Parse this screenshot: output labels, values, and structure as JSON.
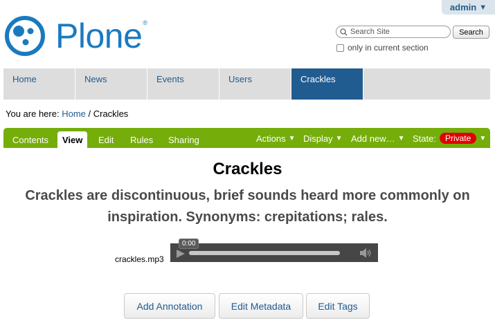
{
  "user_menu": {
    "label": "admin"
  },
  "logo": {
    "text": "Plone",
    "reg_mark": "®"
  },
  "search": {
    "placeholder": "Search Site",
    "button_label": "Search",
    "checkbox_label": "only in current section"
  },
  "portal_tabs": [
    {
      "label": "Home"
    },
    {
      "label": "News"
    },
    {
      "label": "Events"
    },
    {
      "label": "Users"
    },
    {
      "label": "Crackles"
    }
  ],
  "breadcrumb": {
    "prefix": "You are here: ",
    "home": "Home",
    "separator": " / ",
    "current": "Crackles"
  },
  "edit_bar": {
    "tabs": [
      {
        "label": "Contents"
      },
      {
        "label": "View"
      },
      {
        "label": "Edit"
      },
      {
        "label": "Rules"
      },
      {
        "label": "Sharing"
      }
    ],
    "menus": {
      "actions": "Actions",
      "display": "Display",
      "add_new": "Add new…",
      "state_label": "State:",
      "state_value": "Private"
    }
  },
  "content": {
    "title": "Crackles",
    "description": "Crackles are discontinuous, brief sounds heard more commonly on inspiration. Synonyms: crepitations; rales."
  },
  "audio": {
    "filename": "crackles.mp3",
    "time": "0:00"
  },
  "actions": {
    "add_annotation": "Add Annotation",
    "edit_metadata": "Edit Metadata",
    "edit_tags": "Edit Tags"
  },
  "colors": {
    "brand": "#1a7ac0",
    "tab_active": "#205c90",
    "edit_bar": "#75ad0a",
    "state_private": "#e10000"
  }
}
